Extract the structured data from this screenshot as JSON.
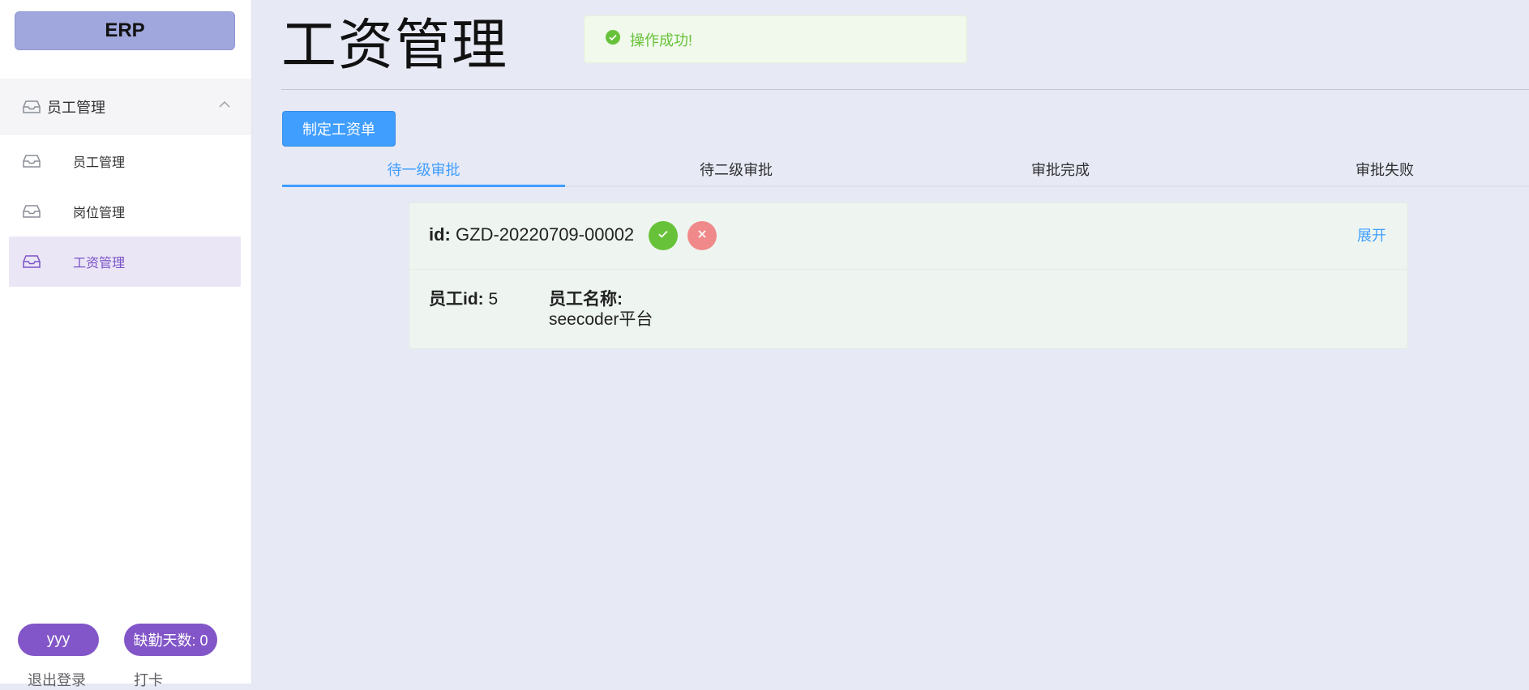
{
  "sidebar": {
    "logo": "ERP",
    "group": {
      "label": "员工管理",
      "icon": "inbox-icon",
      "chevron": "chevron-up-icon"
    },
    "items": [
      {
        "label": "员工管理",
        "icon": "inbox-icon",
        "active": false
      },
      {
        "label": "岗位管理",
        "icon": "inbox-icon",
        "active": false
      },
      {
        "label": "工资管理",
        "icon": "inbox-icon",
        "active": true
      }
    ],
    "user_pill": "yyy",
    "absence_pill": "缺勤天数: 0",
    "logout": "退出登录",
    "clock_in": "打卡"
  },
  "header": {
    "title": "工资管理"
  },
  "toast": {
    "message": "操作成功!",
    "icon": "check-circle-icon",
    "color": "#67c23a"
  },
  "toolbar": {
    "create_label": "制定工资单"
  },
  "tabs": [
    {
      "label": "待一级审批",
      "active": true
    },
    {
      "label": "待二级审批",
      "active": false
    },
    {
      "label": "审批完成",
      "active": false
    },
    {
      "label": "审批失败",
      "active": false
    }
  ],
  "card": {
    "id_label": "id:",
    "id_value": "GZD-20220709-00002",
    "approve_icon": "check-icon",
    "reject_icon": "close-icon",
    "expand_label": "展开",
    "employee_id_label": "员工id:",
    "employee_id_value": "5",
    "employee_name_label": "员工名称:",
    "employee_name_value": "seecoder平台"
  },
  "colors": {
    "primary": "#409eff",
    "success": "#67c23a",
    "danger": "#f08a8a",
    "purple": "#8256c8",
    "logo_bg": "#9fa7dc",
    "page_bg": "#e7e9f5"
  }
}
